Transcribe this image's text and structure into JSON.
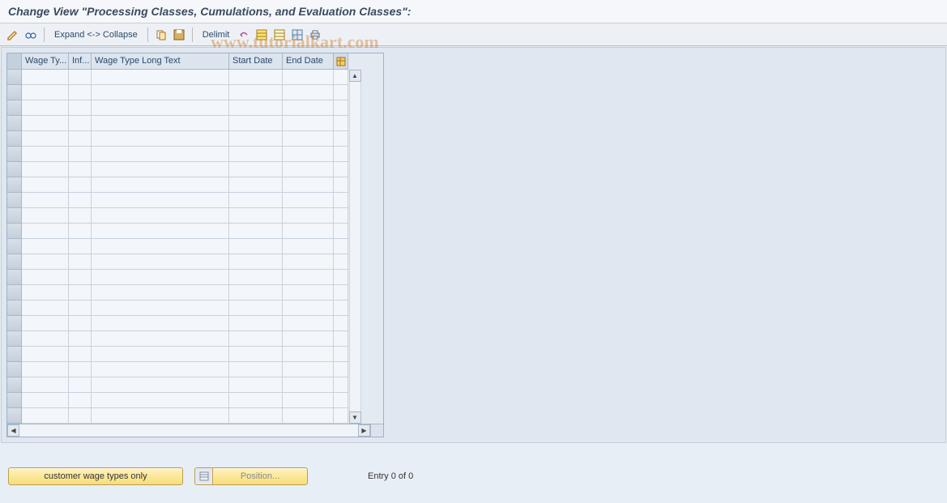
{
  "title": "Change View \"Processing Classes, Cumulations, and Evaluation Classes\":",
  "toolbar": {
    "expand_collapse": "Expand <-> Collapse",
    "delimit": "Delimit"
  },
  "table": {
    "headers": {
      "wage_type": "Wage Ty...",
      "inf": "Inf...",
      "wage_type_long_text": "Wage Type Long Text",
      "start_date": "Start Date",
      "end_date": "End Date"
    },
    "rows": []
  },
  "buttons": {
    "customer_wage_types": "customer wage types only",
    "position": "Position..."
  },
  "status": {
    "entry_text": "Entry 0 of 0"
  },
  "watermark": "www.tutorialkart.com"
}
